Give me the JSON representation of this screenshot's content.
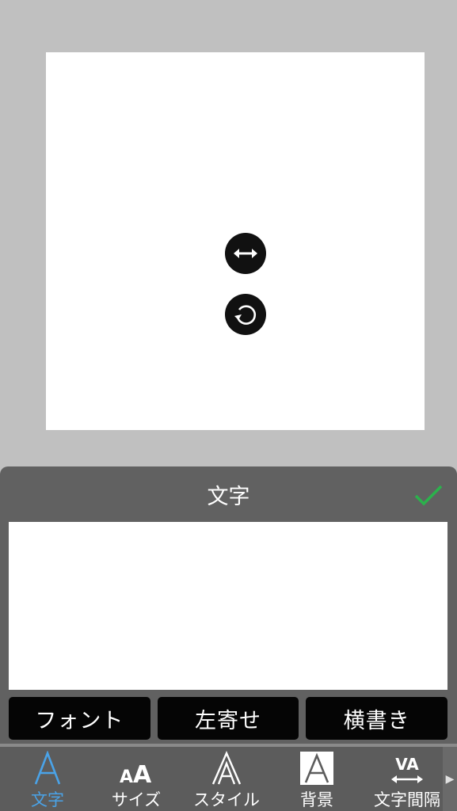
{
  "editor": {
    "handles": [
      {
        "icon": "resize-horizontal-icon"
      },
      {
        "icon": "rotate-icon"
      }
    ]
  },
  "panel": {
    "title": "文字",
    "confirm_icon": "checkmark-icon",
    "confirm_color": "#2bb24c",
    "text_value": "",
    "options": {
      "font": "フォント",
      "align": "左寄せ",
      "direction": "横書き"
    }
  },
  "tabs": {
    "items": [
      {
        "label": "文字",
        "icon": "letter-a-icon",
        "active": true
      },
      {
        "label": "サイズ",
        "icon": "font-size-icon",
        "active": false
      },
      {
        "label": "スタイル",
        "icon": "outline-letter-icon",
        "active": false
      },
      {
        "label": "背景",
        "icon": "letter-background-icon",
        "active": false
      },
      {
        "label": "文字間隔",
        "icon": "letter-spacing-icon",
        "active": false
      }
    ],
    "active_color": "#4aa3e8",
    "more_icon": "triangle-right-icon"
  }
}
